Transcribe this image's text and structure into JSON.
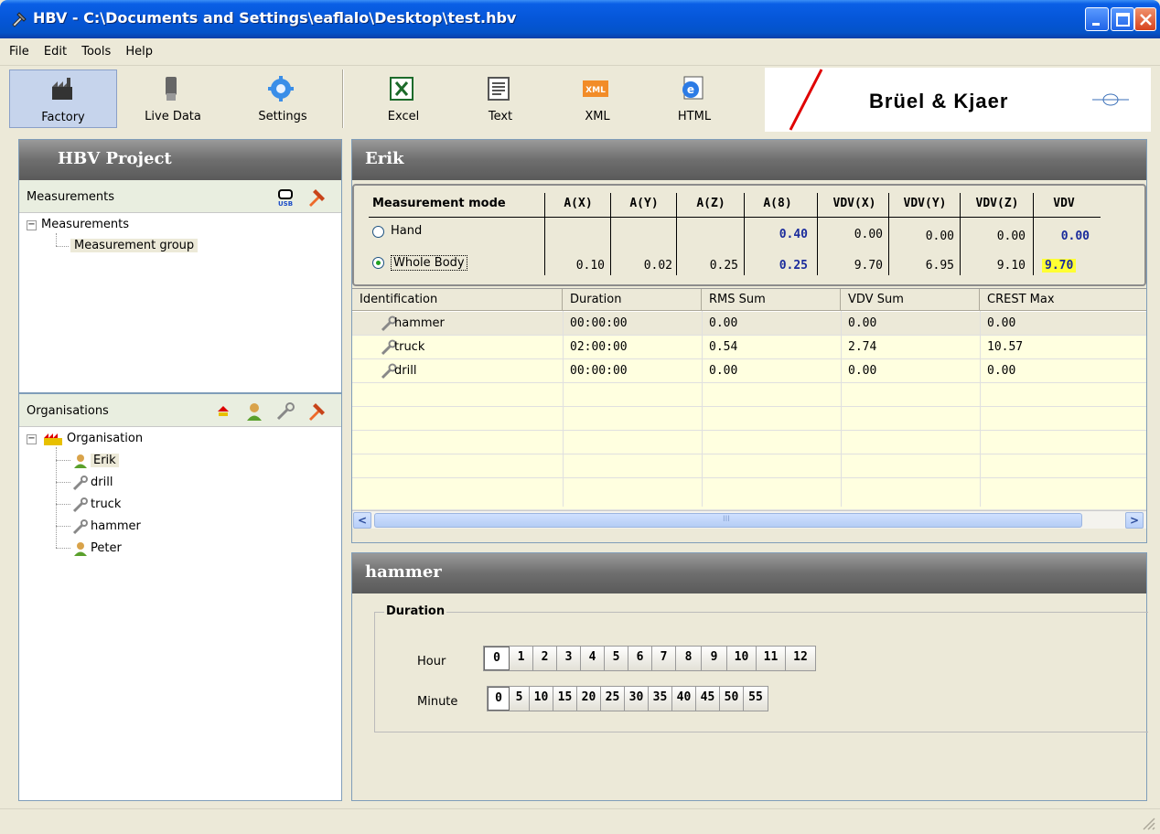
{
  "window": {
    "title": "HBV - C:\\Documents and Settings\\eaflalo\\Desktop\\test.hbv"
  },
  "menu": [
    "File",
    "Edit",
    "Tools",
    "Help"
  ],
  "toolbar": {
    "factory": "Factory",
    "live_data": "Live Data",
    "settings": "Settings",
    "excel": "Excel",
    "text": "Text",
    "xml": "XML",
    "html": "HTML",
    "xml_icon_text": "XML"
  },
  "brand": "Brüel & Kjaer",
  "left": {
    "title": "HBV Project",
    "measurements_label": "Measurements",
    "measurements_tree": {
      "root": "Measurements",
      "child": "Measurement group"
    },
    "organisations_label": "Organisations",
    "org_tree": {
      "root": "Organisation",
      "items": [
        "Erik",
        "drill",
        "truck",
        "hammer",
        "Peter"
      ]
    }
  },
  "erik": {
    "title": "Erik",
    "mode_header": "Measurement mode",
    "columns": [
      "A(X)",
      "A(Y)",
      "A(Z)",
      "A(8)",
      "VDV(X)",
      "VDV(Y)",
      "VDV(Z)",
      "VDV"
    ],
    "hand": {
      "label": "Hand",
      "values": [
        "",
        "",
        "",
        "0.40",
        "0.00",
        "0.00",
        "0.00",
        "0.00"
      ]
    },
    "whole_body": {
      "label": "Whole Body",
      "values": [
        "0.10",
        "0.02",
        "0.25",
        "0.25",
        "9.70",
        "6.95",
        "9.10",
        "9.70"
      ]
    },
    "selected_mode": "Whole Body"
  },
  "grid": {
    "headers": [
      "Identification",
      "Duration",
      "RMS Sum",
      "VDV Sum",
      "CREST Max"
    ],
    "rows": [
      [
        "hammer",
        "00:00:00",
        "0.00",
        "0.00",
        "0.00"
      ],
      [
        "truck",
        "02:00:00",
        "0.54",
        "2.74",
        "10.57"
      ],
      [
        "drill",
        "00:00:00",
        "0.00",
        "0.00",
        "0.00"
      ]
    ],
    "scroll_grip": "III"
  },
  "hammer": {
    "title": "hammer",
    "group": "Duration",
    "hour_label": "Hour",
    "minute_label": "Minute",
    "hours": [
      "0",
      "1",
      "2",
      "3",
      "4",
      "5",
      "6",
      "7",
      "8",
      "9",
      "10",
      "11",
      "12"
    ],
    "minutes": [
      "0",
      "5",
      "10",
      "15",
      "20",
      "25",
      "30",
      "35",
      "40",
      "45",
      "50",
      "55"
    ],
    "selected_hour": "0",
    "selected_minute": "0"
  },
  "colors": {
    "title_blue": "#0556d8",
    "value_blue": "#1a2b9c",
    "highlight": "#ffff33",
    "grid_row": "#ffffe0"
  }
}
